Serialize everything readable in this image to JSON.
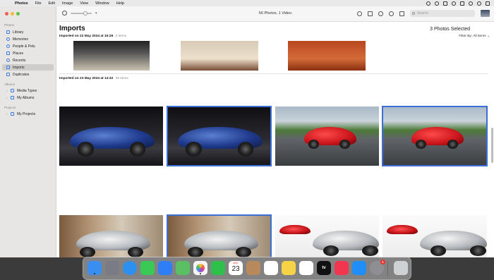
{
  "menubar": {
    "app_name": "Photos",
    "items": [
      "File",
      "Edit",
      "Image",
      "View",
      "Window",
      "Help"
    ]
  },
  "sidebar": {
    "section_photos": "Photos",
    "photos_items": [
      {
        "label": "Library",
        "icon": "library-icon"
      },
      {
        "label": "Memories",
        "icon": "memories-icon"
      },
      {
        "label": "People & Pets",
        "icon": "people-icon"
      },
      {
        "label": "Places",
        "icon": "places-icon"
      },
      {
        "label": "Recents",
        "icon": "recents-icon"
      },
      {
        "label": "Imports",
        "icon": "imports-icon",
        "active": true
      },
      {
        "label": "Duplicates",
        "icon": "duplicates-icon"
      }
    ],
    "section_albums": "Albums",
    "albums_items": [
      {
        "label": "Media Types",
        "icon": "folder-icon"
      },
      {
        "label": "My Albums",
        "icon": "folder-icon"
      }
    ],
    "section_projects": "Projects",
    "projects_items": [
      {
        "label": "My Projects",
        "icon": "folder-icon"
      }
    ]
  },
  "toolbar": {
    "title": "56 Photos, 1 Video",
    "search_placeholder": "Search",
    "zoom_level": 0.6
  },
  "content": {
    "page_title": "Imports",
    "selected_count": "3 Photos Selected",
    "filter_label": "Filter By: All Items",
    "import_groups": [
      {
        "prefix": "Imported on 22 May 2024 at 15:26",
        "count": "3 items"
      },
      {
        "prefix": "Imported on 23 May 2024 at 14:32",
        "count": "36 items"
      }
    ]
  },
  "dock": {
    "apps": [
      {
        "name": "finder-icon",
        "color": "#3a8ef0"
      },
      {
        "name": "launchpad-icon",
        "color": "#7b7b85"
      },
      {
        "name": "safari-icon",
        "color": "#2d8ff0"
      },
      {
        "name": "messages-icon",
        "color": "#3bc955"
      },
      {
        "name": "mail-icon",
        "color": "#2f7ef6"
      },
      {
        "name": "maps-icon",
        "color": "#5bbf63"
      },
      {
        "name": "photos-icon",
        "color": "#f4f4f4"
      },
      {
        "name": "facetime-icon",
        "color": "#2fbf4b"
      },
      {
        "name": "calendar-icon",
        "color": "#ffffff"
      },
      {
        "name": "contacts-icon",
        "color": "#b8895a"
      },
      {
        "name": "reminders-icon",
        "color": "#ffffff"
      },
      {
        "name": "notes-icon",
        "color": "#f6d247"
      },
      {
        "name": "freeform-icon",
        "color": "#ffffff"
      },
      {
        "name": "tv-icon",
        "color": "#111111"
      },
      {
        "name": "music-icon",
        "color": "#f3364f"
      },
      {
        "name": "app-store-icon",
        "color": "#1f8ef6"
      },
      {
        "name": "system-settings-icon",
        "color": "#8e8e93"
      },
      {
        "name": "trash-icon",
        "color": "#cfd2d4"
      }
    ],
    "calendar_month": "MAY",
    "calendar_day": "23",
    "tv_label": "tv",
    "settings_badge": "1"
  },
  "colors": {
    "selection": "#3b6fd6",
    "accent": "#3c7bd9"
  }
}
